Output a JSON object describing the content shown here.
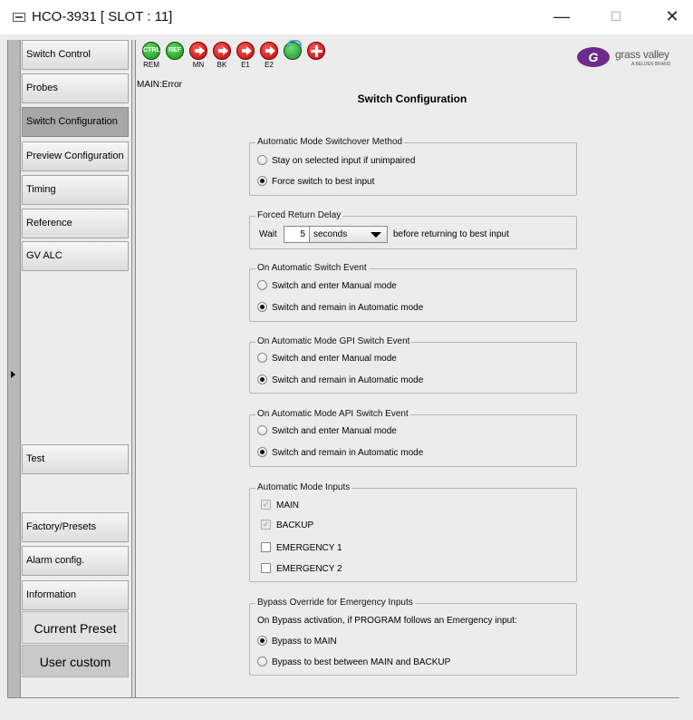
{
  "window": {
    "title": "HCO-3931 [ SLOT : 11]",
    "minimize": "—",
    "maximize": "☐",
    "close": "✕"
  },
  "sidebar": {
    "items": [
      {
        "label": "Switch Control"
      },
      {
        "label": "Probes"
      },
      {
        "label": "Switch Configuration",
        "active": true
      },
      {
        "label": "Preview Configuration"
      },
      {
        "label": "Timing"
      },
      {
        "label": "Reference"
      },
      {
        "label": "GV ALC"
      }
    ],
    "lower_items": [
      {
        "label": "Test"
      },
      {
        "label": "Factory/Presets"
      },
      {
        "label": "Alarm config."
      },
      {
        "label": "Information"
      }
    ],
    "current_preset_label": "Current Preset",
    "preset_value": "User custom"
  },
  "toolbar": {
    "icons": [
      {
        "name": "ctrl-rem-status-icon",
        "glyph": "CTRL",
        "label": "REM",
        "kind": "green"
      },
      {
        "name": "ref-status-icon",
        "glyph": "REF",
        "label": "",
        "kind": "green"
      },
      {
        "name": "main-input-icon",
        "glyph": "",
        "label": "MN",
        "kind": "red"
      },
      {
        "name": "backup-input-icon",
        "glyph": "",
        "label": "BK",
        "kind": "red"
      },
      {
        "name": "emergency1-input-icon",
        "glyph": "",
        "label": "E1",
        "kind": "red"
      },
      {
        "name": "emergency2-input-icon",
        "glyph": "",
        "label": "E2",
        "kind": "red"
      },
      {
        "name": "bypass-status-icon",
        "glyph": "",
        "label": "",
        "kind": "teal"
      },
      {
        "name": "alarm-plus-icon",
        "glyph": "",
        "label": "",
        "kind": "plus"
      }
    ],
    "logo_text": "grass valley",
    "logo_sub": "A BELDEN BRAND"
  },
  "status_text": "MAIN:Error",
  "page_title": "Switch Configuration",
  "groups": {
    "switchover": {
      "legend": "Automatic Mode Switchover Method",
      "options": [
        "Stay on selected input if unimpaired",
        "Force switch to best input"
      ],
      "selected": 1
    },
    "forced_return": {
      "legend": "Forced Return Delay",
      "wait_label": "Wait",
      "value": "5",
      "unit": "seconds",
      "suffix": "before returning to best input"
    },
    "auto_switch_event": {
      "legend": "On Automatic Switch Event",
      "options": [
        "Switch and enter Manual mode",
        "Switch and remain in Automatic mode"
      ],
      "selected": 1
    },
    "gpi_switch_event": {
      "legend": "On Automatic Mode GPI Switch Event",
      "options": [
        "Switch and enter Manual mode",
        "Switch and remain in Automatic mode"
      ],
      "selected": 1
    },
    "api_switch_event": {
      "legend": "On Automatic Mode API Switch Event",
      "options": [
        "Switch and enter Manual mode",
        "Switch and remain in Automatic mode"
      ],
      "selected": 1
    },
    "auto_inputs": {
      "legend": "Automatic Mode Inputs",
      "items": [
        {
          "label": "MAIN",
          "checked": true,
          "disabled": true
        },
        {
          "label": "BACKUP",
          "checked": true,
          "disabled": true
        },
        {
          "label": "EMERGENCY 1",
          "checked": false,
          "disabled": false
        },
        {
          "label": "EMERGENCY 2",
          "checked": false,
          "disabled": false
        }
      ]
    },
    "bypass_override": {
      "legend": "Bypass Override for Emergency Inputs",
      "description": "On Bypass activation, if PROGRAM follows an Emergency input:",
      "options": [
        "Bypass to MAIN",
        "Bypass to best between MAIN and BACKUP"
      ],
      "selected": 0
    }
  }
}
